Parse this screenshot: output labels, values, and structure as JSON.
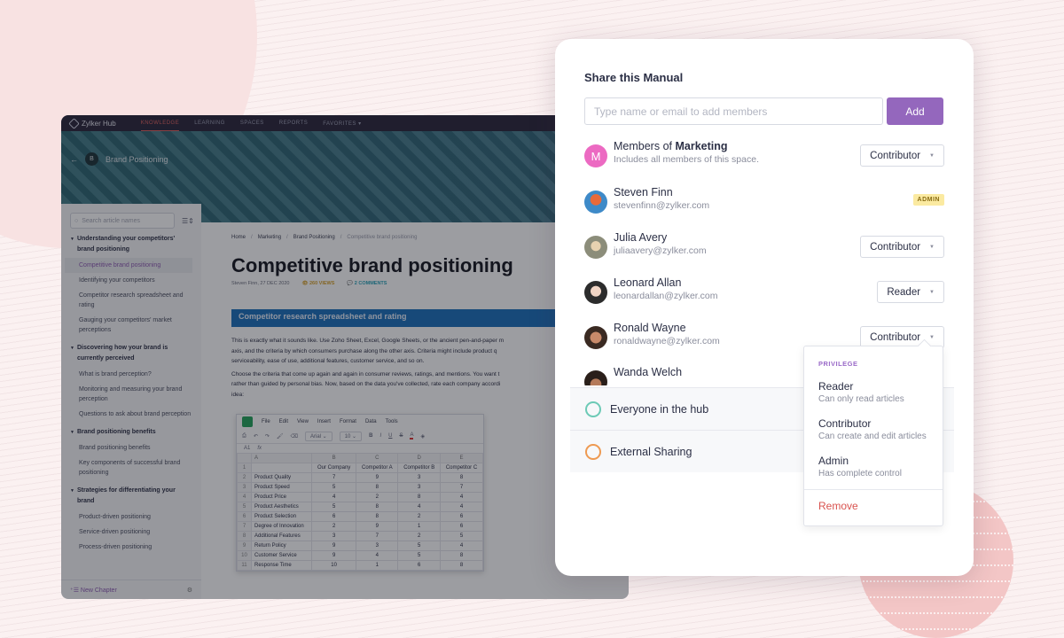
{
  "app": {
    "brand": "Zylker Hub",
    "nav": [
      {
        "label": "KNOWLEDGE",
        "active": true
      },
      {
        "label": "LEARNING",
        "active": false
      },
      {
        "label": "SPACES",
        "active": false
      },
      {
        "label": "REPORTS",
        "active": false
      },
      {
        "label": "FAVORITES ▾",
        "active": false
      }
    ],
    "space": {
      "badge": "B",
      "name": "Brand Positioning"
    },
    "sidebar": {
      "search_placeholder": "Search article names",
      "chapters": [
        {
          "title": "Understanding your competitors' brand positioning",
          "articles": [
            "Competitive brand positioning",
            "Identifying your competitors",
            "Competitor research spreadsheet and rating",
            "Gauging your competitors' market perceptions"
          ]
        },
        {
          "title": "Discovering how your brand is currently perceived",
          "articles": [
            "What is brand perception?",
            "Monitoring and measuring your brand perception",
            "Questions to ask about brand perception"
          ]
        },
        {
          "title": "Brand positioning benefits",
          "articles": [
            "Brand positioning benefits",
            "Key components of successful brand positioning"
          ]
        },
        {
          "title": "Strategies for differentiating your brand",
          "articles": [
            "Product-driven positioning",
            "Service-driven positioning",
            "Process-driven positioning"
          ]
        }
      ],
      "active_article": "Competitive brand positioning",
      "new_chapter": "New Chapter"
    },
    "article": {
      "breadcrumb": [
        "Home",
        "Marketing",
        "Brand Positioning",
        "Competitive brand positioning"
      ],
      "title": "Competitive brand positioning",
      "author": "Steven Finn",
      "date": ", 27 DEC 2020",
      "views": "260 VIEWS",
      "comments": "2 COMMENTS",
      "section": "Competitor research spreadsheet and rating",
      "para1_l1": "This is exactly what it sounds like. Use Zoho Sheet, Excel, Google Sheets, or the ancient pen-and-paper m",
      "para1_l2": "axis, and the criteria by which consumers purchase along the other axis. Criteria might include product q",
      "para1_l3": "serviceability, ease of use, additional features, customer service, and so on.",
      "para2_l1": "Choose the criteria that come up again and again in consumer reviews, ratings, and mentions. You want t",
      "para2_l2": "rather than guided by personal bias. Now, based on the data you've collected, rate each company accordi",
      "para2_l3": "idea:"
    },
    "sheet": {
      "menu": [
        "File",
        "Edit",
        "View",
        "Insert",
        "Format",
        "Data",
        "Tools"
      ],
      "font": "Arial",
      "size": "10",
      "cell_ref": "A1",
      "fx": "fx",
      "col_letters": [
        "A",
        "B",
        "C",
        "D",
        "E"
      ],
      "headers": [
        "",
        "Our Company",
        "Competitor A",
        "Competitor B",
        "Competitor C"
      ],
      "rows": [
        [
          "Product Quality",
          "7",
          "9",
          "3",
          "8"
        ],
        [
          "Product Speed",
          "5",
          "8",
          "3",
          "7"
        ],
        [
          "Product Price",
          "4",
          "2",
          "8",
          "4"
        ],
        [
          "Product Aesthetics",
          "5",
          "8",
          "4",
          "4"
        ],
        [
          "Product Selection",
          "6",
          "8",
          "2",
          "6"
        ],
        [
          "Degree of Innovation",
          "2",
          "9",
          "1",
          "6"
        ],
        [
          "Additional Features",
          "3",
          "7",
          "2",
          "5"
        ],
        [
          "Return Policy",
          "9",
          "3",
          "5",
          "4"
        ],
        [
          "Customer Service",
          "9",
          "4",
          "5",
          "8"
        ],
        [
          "Response Time",
          "10",
          "1",
          "6",
          "8"
        ]
      ]
    }
  },
  "share": {
    "title": "Share this Manual",
    "input_placeholder": "Type name or email to add members",
    "add_label": "Add",
    "group": {
      "initial": "M",
      "name_prefix": "Members of ",
      "name_bold": "Marketing",
      "sub": "Includes all members of this space.",
      "role": "Contributor"
    },
    "members": [
      {
        "name": "Steven Finn",
        "email": "stevenfinn@zylker.com",
        "role": "ADMIN",
        "is_badge": true
      },
      {
        "name": "Julia Avery",
        "email": "juliaavery@zylker.com",
        "role": "Contributor"
      },
      {
        "name": "Leonard Allan",
        "email": "leonardallan@zylker.com",
        "role": "Reader"
      },
      {
        "name": "Ronald Wayne",
        "email": "ronaldwayne@zylker.com",
        "role": "Contributor"
      },
      {
        "name": "Wanda Welch",
        "email": ""
      }
    ],
    "options": [
      {
        "label": "Everyone in the hub",
        "icon": "globe-icon"
      },
      {
        "label": "External Sharing",
        "icon": "external-globe-icon"
      }
    ],
    "dropdown": {
      "heading": "PRIVILEGE",
      "items": [
        {
          "title": "Reader",
          "desc": "Can only read articles"
        },
        {
          "title": "Contributor",
          "desc": "Can create and edit articles"
        },
        {
          "title": "Admin",
          "desc": "Has complete control"
        }
      ],
      "remove": "Remove"
    },
    "colors": {
      "accent": "#9467bd",
      "remove": "#d9534f",
      "admin_badge": "#fbeaa1",
      "group_avatar": "#ec6ac2"
    }
  }
}
